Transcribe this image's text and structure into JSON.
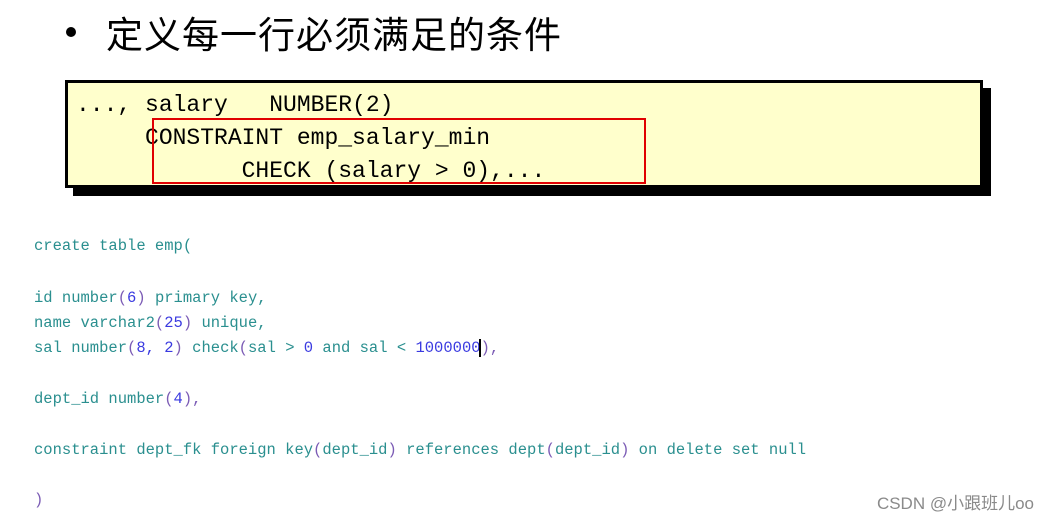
{
  "heading": {
    "bullet_icon": "bullet-dot",
    "text": "定义每一行必须满足的条件"
  },
  "code_example": {
    "lines": [
      "..., salary   NUMBER(2)",
      "     CONSTRAINT emp_salary_min",
      "            CHECK (salary > 0),..."
    ],
    "highlight_color": "#e00000",
    "background_color": "#ffffcc"
  },
  "sql_editor": {
    "lines": {
      "l1": "create table emp(",
      "l2a": "id number",
      "l2b": "(",
      "l2c": "6",
      "l2d": ")",
      "l2e": " primary key,",
      "l3a": "name varchar2",
      "l3b": "(",
      "l3c": "25",
      "l3d": ")",
      "l3e": " unique,",
      "l4a": "sal number",
      "l4b": "(",
      "l4c": "8, 2",
      "l4d": ")",
      "l4e": " check",
      "l4f": "(",
      "l4g": "sal > ",
      "l4h": "0",
      "l4i": " and sal < ",
      "l4j": "1000000",
      "l4k": "),",
      "l5a": "dept_id number",
      "l5b": "(",
      "l5c": "4",
      "l5d": "),",
      "l6a": "constraint dept_fk foreign key",
      "l6b": "(",
      "l6c": "dept_id",
      "l6d": ")",
      "l6e": " references dept",
      "l6f": "(",
      "l6g": "dept_id",
      "l6h": ")",
      "l6i": " on delete set null",
      "l7": ")"
    },
    "text_color": "#2a8f8f",
    "number_color": "#3a3ae0"
  },
  "watermark": "CSDN @小跟班儿oo"
}
